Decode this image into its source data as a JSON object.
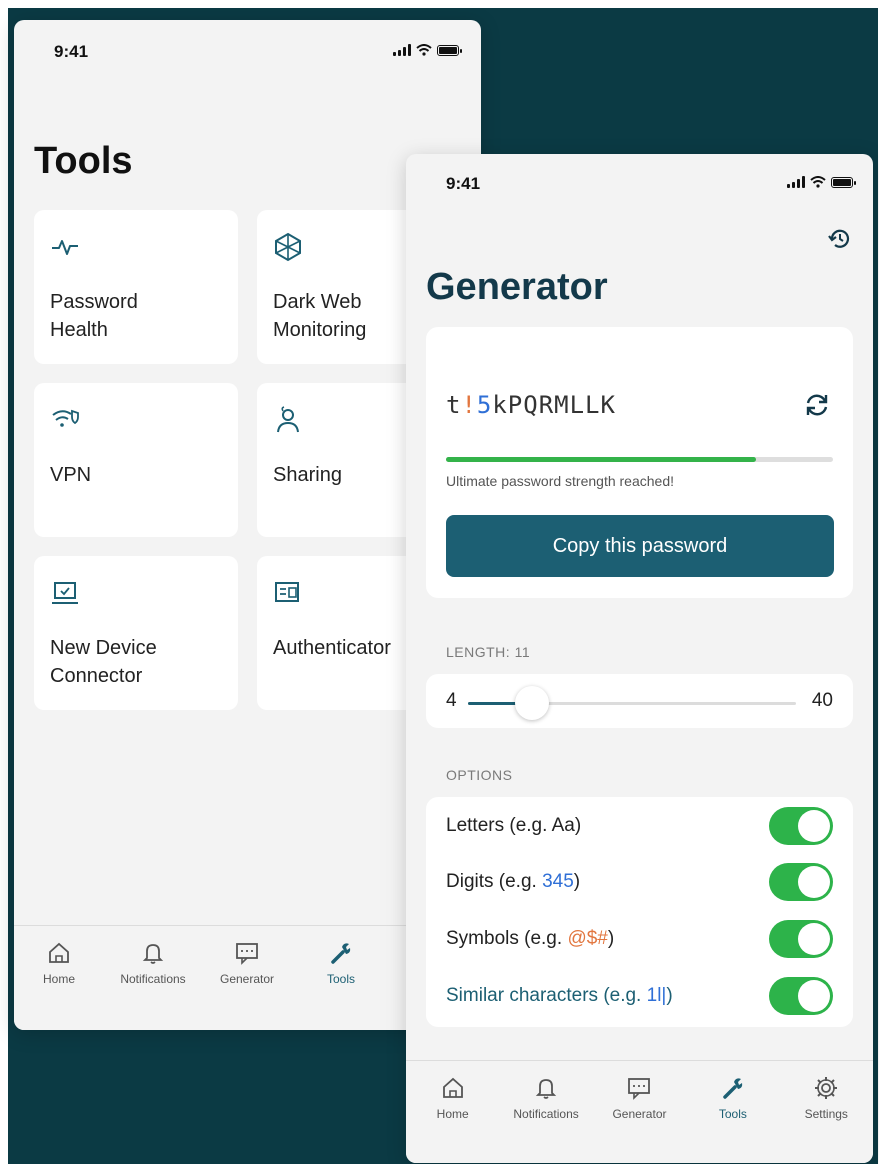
{
  "tools_screen": {
    "status_time": "9:41",
    "title": "Tools",
    "tiles": [
      {
        "label": "Password\nHealth",
        "icon": "pulse-icon"
      },
      {
        "label": "Dark Web\nMonitoring",
        "icon": "web-icon"
      },
      {
        "label": "VPN",
        "icon": "vpn-icon"
      },
      {
        "label": "Sharing",
        "icon": "sharing-icon"
      },
      {
        "label": "New Device\nConnector",
        "icon": "laptop-icon"
      },
      {
        "label": "Authenticator",
        "icon": "authenticator-icon"
      }
    ],
    "tabs": [
      {
        "label": "Home",
        "icon": "home-icon"
      },
      {
        "label": "Notifications",
        "icon": "bell-icon"
      },
      {
        "label": "Generator",
        "icon": "generator-icon"
      },
      {
        "label": "Tools",
        "icon": "wrench-icon",
        "active": true
      }
    ]
  },
  "generator_screen": {
    "status_time": "9:41",
    "title": "Generator",
    "password": {
      "part1": "t",
      "part2": "!",
      "part3": "5",
      "part4": "kPQRMLLK"
    },
    "strength_fraction": 0.8,
    "strength_text": "Ultimate password strength reached!",
    "copy_label": "Copy this password",
    "length_label": "LENGTH: 11",
    "length": {
      "min": "4",
      "max": "40",
      "value": 11
    },
    "options_label": "OPTIONS",
    "options": [
      {
        "prefix": "Letters (e.g. Aa)",
        "example": "",
        "suffix": "",
        "enabled": true
      },
      {
        "prefix": "Digits (e.g. ",
        "example": "345",
        "suffix": ")",
        "enabled": true
      },
      {
        "prefix": "Symbols (e.g. ",
        "example": "@$#",
        "suffix": ")",
        "enabled": true
      },
      {
        "prefix": "Similar characters (e.g. ",
        "example": "1l|",
        "suffix": ")",
        "enabled": true
      }
    ],
    "tabs": [
      {
        "label": "Home",
        "icon": "home-icon"
      },
      {
        "label": "Notifications",
        "icon": "bell-icon"
      },
      {
        "label": "Generator",
        "icon": "generator-icon"
      },
      {
        "label": "Tools",
        "icon": "wrench-icon",
        "active": true
      },
      {
        "label": "Settings",
        "icon": "gear-icon"
      }
    ]
  },
  "colors": {
    "background": "#0b3a44",
    "accent": "#1c5f73",
    "toggle_on": "#2db34a",
    "strength": "#34b34a",
    "digit_highlight": "#2f6fd6",
    "symbol_highlight": "#e2763f"
  }
}
